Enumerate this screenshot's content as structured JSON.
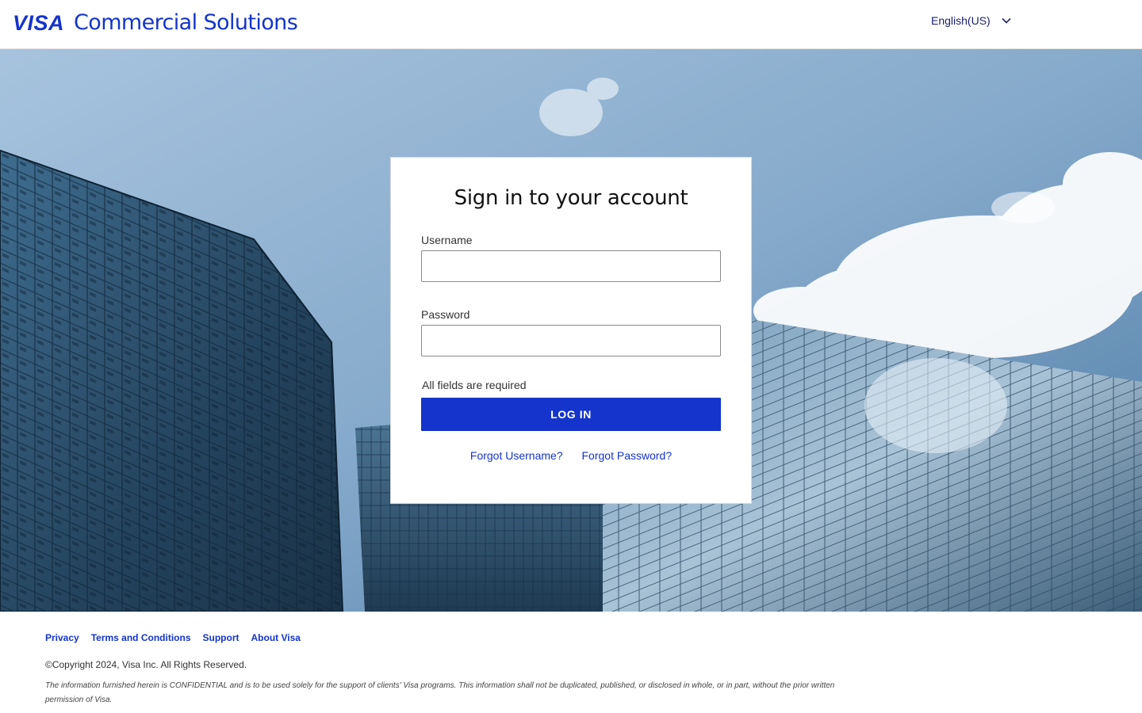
{
  "header": {
    "logo_text": "VISA",
    "product_name": "Commercial Solutions",
    "language": "English(US)",
    "language_icon": "chevron-down-icon"
  },
  "colors": {
    "brand_blue": "#1434cb",
    "link_navy": "#1a1f71"
  },
  "login": {
    "title": "Sign in to your account",
    "username_label": "Username",
    "username_value": "",
    "password_label": "Password",
    "password_value": "",
    "required_note": "All fields are required",
    "login_button": "LOG IN",
    "forgot_username": "Forgot Username?",
    "forgot_password": "Forgot Password?"
  },
  "footer": {
    "links": [
      "Privacy",
      "Terms and Conditions",
      "Support",
      "About Visa"
    ],
    "copyright": "©Copyright 2024, Visa Inc. All Rights Reserved.",
    "disclaimer": "The information furnished herein is CONFIDENTIAL and is to be used solely for the support of clients' Visa programs. This information shall not be duplicated, published, or disclosed in whole, or in part, without the prior written permission of Visa."
  }
}
